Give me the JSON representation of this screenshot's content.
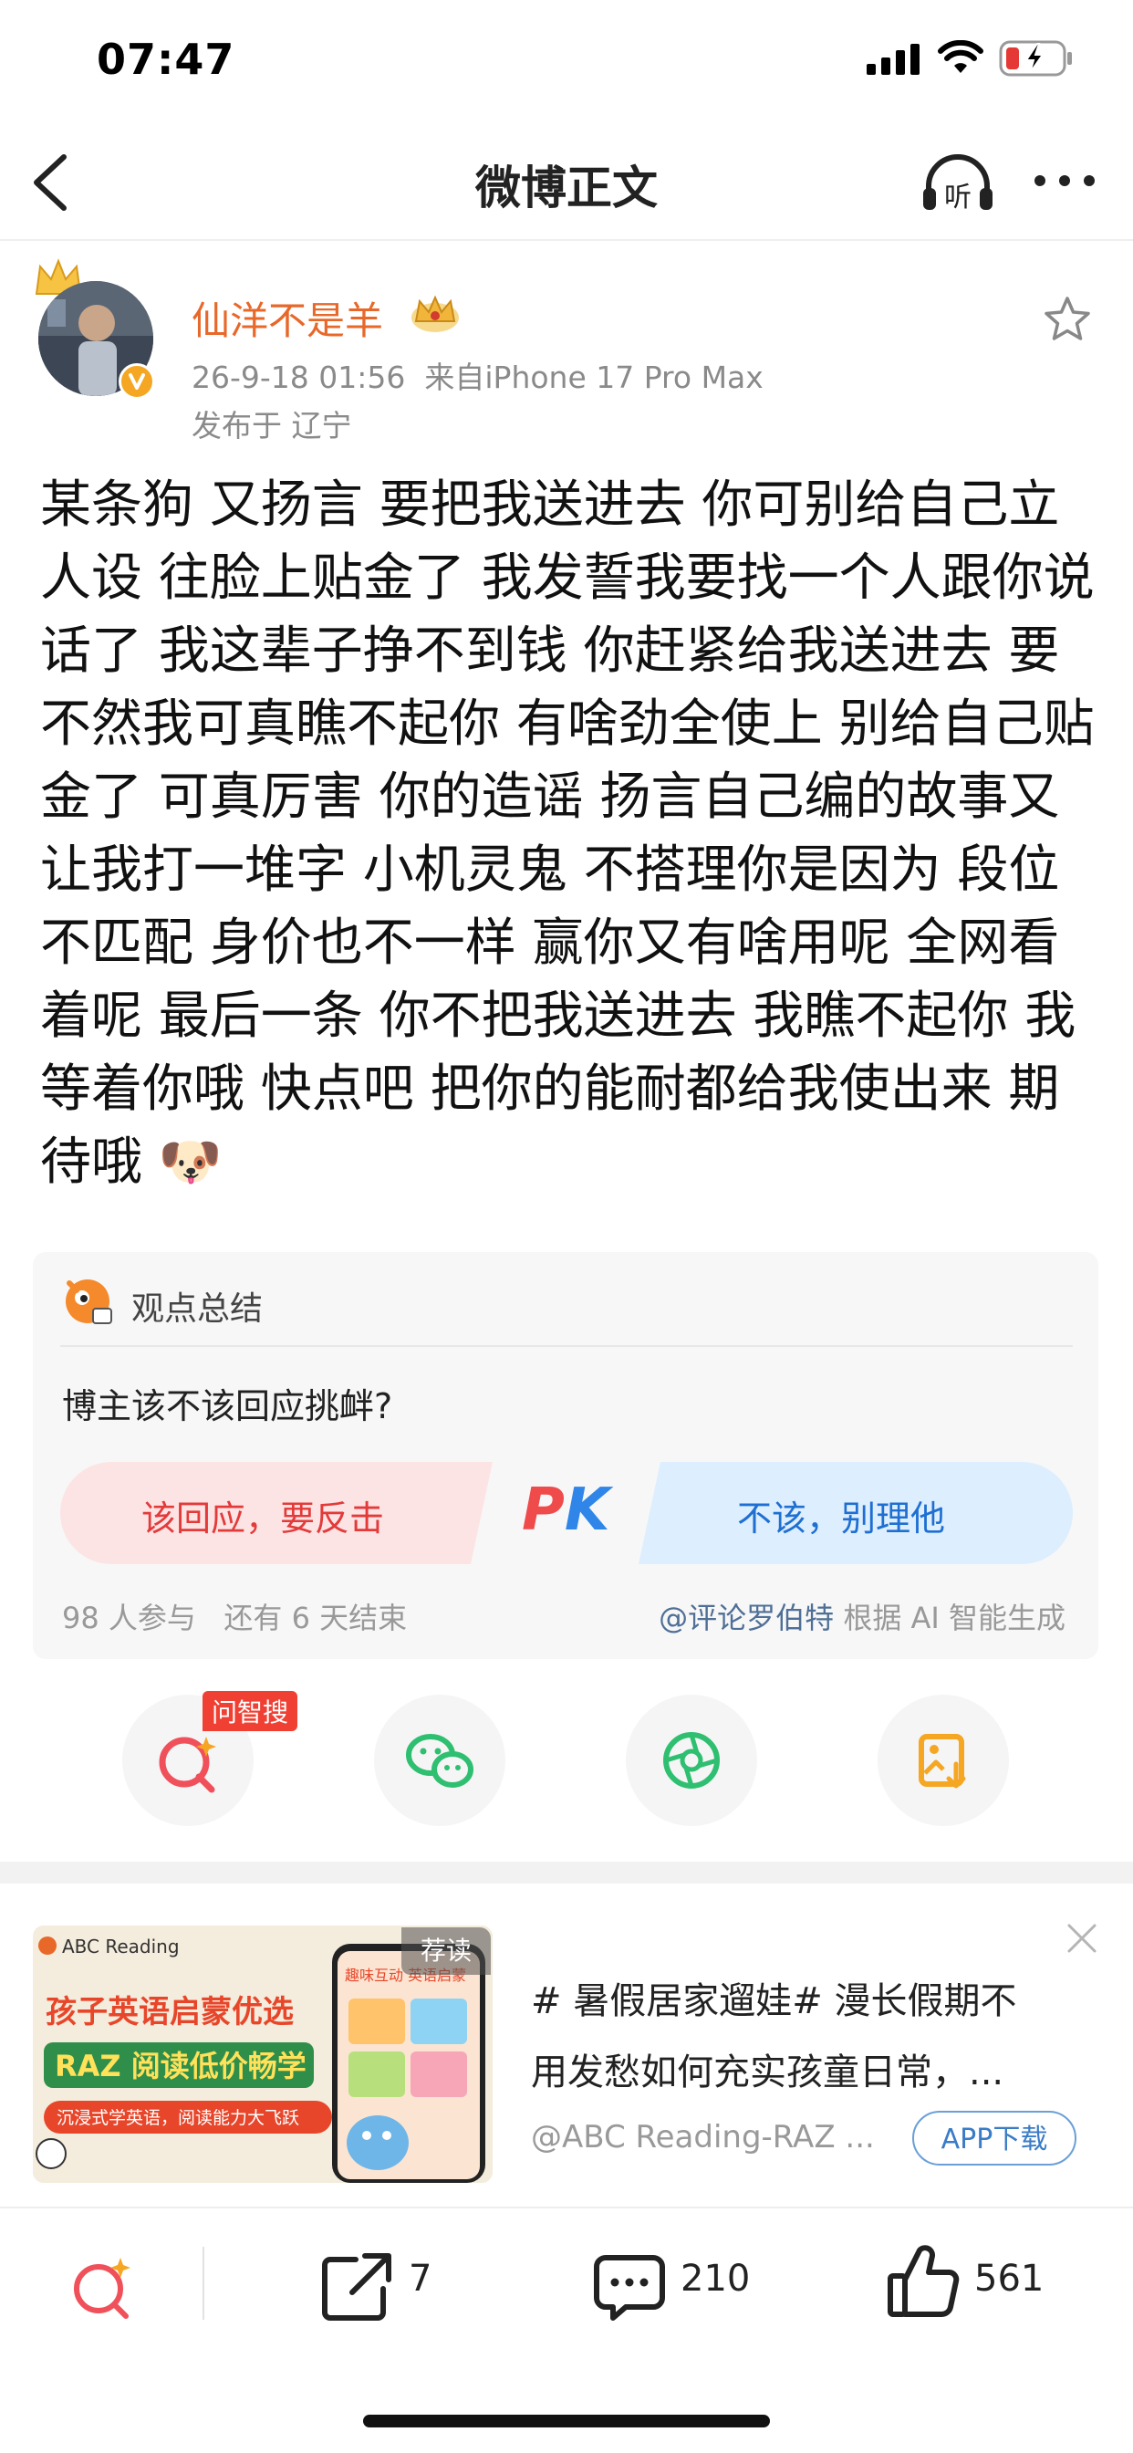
{
  "status_bar": {
    "time": "07:47"
  },
  "nav": {
    "title": "微博正文"
  },
  "author": {
    "name": "仙洋不是羊",
    "datetime": "26-9-18 01:56",
    "source": "来自iPhone 17 Pro Max",
    "location": "发布于 辽宁"
  },
  "post": {
    "text": "某条狗 又扬言 要把我送进去 你可别给自己立人设 往脸上贴金了 我发誓我要找一个人跟你说话了 我这辈子挣不到钱 你赶紧给我送进去 要不然我可真瞧不起你 有啥劲全使上 别给自己贴金了 可真厉害 你的造谣 扬言自己编的故事又让我打一堆字 小机灵鬼 不搭理你是因为 段位不匹配 身价也不一样 赢你又有啥用呢 全网看着呢 最后一条 你不把我送进去 我瞧不起你 我等着你哦 快点吧 把你的能耐都给我使出来 期待哦",
    "emoji": "🐶"
  },
  "poll": {
    "header": "观点总结",
    "question": "博主该不该回应挑衅?",
    "option_left": "该回应，要反击",
    "pk": "PK",
    "option_right": "不该，别理他",
    "participants": "98 人参与",
    "time_left": "还有 6 天结束",
    "credit_user": "@评论罗伯特",
    "credit_suffix": "根据 AI 智能生成"
  },
  "share": {
    "badge": "问智搜"
  },
  "ad": {
    "recommend_tag": "荐读",
    "brand": "ABC Reading",
    "banner_line1": "孩子英语启蒙优选",
    "banner_line2": "RAZ 阅读低价畅学",
    "banner_line3": "沉浸式学英语，阅读能力大飞跃",
    "phone_title": "趣味互动 英语启蒙",
    "line1": "# 暑假居家遛娃# 漫长假期不",
    "line2": "用发愁如何充实孩童日常，...",
    "source": "@ABC Reading-RAZ ...",
    "download": "APP下载"
  },
  "toolbar": {
    "repost_count": "7",
    "comment_count": "210",
    "like_count": "561"
  },
  "colors": {
    "author_name": "#e8682a",
    "poll_left": "#e33a3a",
    "poll_right": "#1f6fd2",
    "badge": "#f04033"
  }
}
